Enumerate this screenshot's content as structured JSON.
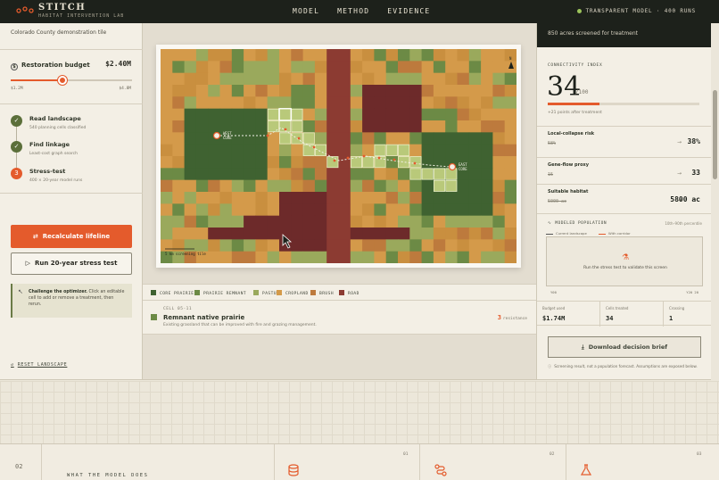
{
  "nav": {
    "title": "STITCH",
    "subtitle": "HABITAT INTERVENTION LAB",
    "links": [
      "MODEL",
      "METHOD",
      "EVIDENCE"
    ],
    "status": "TRANSPARENT MODEL · 400 RUNS"
  },
  "left": {
    "tile_label": "Colorado County demonstration tile",
    "budget_label": "Restoration budget",
    "budget_value": "$2.40M",
    "slider_min": "$1.2M",
    "slider_max": "$4.8M",
    "slider_fraction": 0.43,
    "steps": [
      {
        "title": "Read landscape",
        "sub": "540 planning cells classified",
        "marker": "✓"
      },
      {
        "title": "Find linkage",
        "sub": "Least-cost graph search",
        "marker": "✓"
      },
      {
        "title": "Stress-test",
        "sub": "400 × 20-year model runs",
        "marker": "3"
      }
    ],
    "recalc_label": "Recalculate lifeline",
    "stress_label": "Run 20-year stress test",
    "tip_bold": "Challenge the optimizer.",
    "tip_text": " Click an editable cell to add or remove a treatment, then rerun.",
    "reset_label": "RESET LANDSCAPE"
  },
  "map": {
    "west_label": [
      "WEST",
      "CORE"
    ],
    "east_label": [
      "EAST",
      "CORE"
    ],
    "scale_label": "5 km screening tile",
    "north": "N",
    "colors": {
      "core": "#3f6231",
      "remnant": "#6c8a45",
      "pasture": "#9aa95c",
      "cropland": "#d49a4a",
      "brush": "#bd7a3d",
      "road": "#8c3b32",
      "crop_alt": "#c98f3f",
      "dark": "#6d2a2a"
    }
  },
  "legend": [
    {
      "label": "CORE PRAIRIE",
      "color": "#3f6231"
    },
    {
      "label": "PRAIRIE REMNANT",
      "color": "#6c8a45"
    },
    {
      "label": "PASTURE",
      "color": "#9aa95c"
    },
    {
      "label": "CROPLAND",
      "color": "#d49a4a"
    },
    {
      "label": "BRUSH",
      "color": "#bd7a3d"
    },
    {
      "label": "ROAD",
      "color": "#8c3b32"
    }
  ],
  "cell": {
    "id": "CELL 05-11",
    "name": "Remnant native prairie",
    "desc": "Existing grassland that can be improved with fire and grazing management.",
    "resistance_value": "3",
    "resistance_label": "resistance"
  },
  "right": {
    "top_text": "850 acres screened for treatment",
    "conn_label": "CONNECTIVITY INDEX",
    "conn_value": "34",
    "conn_of": "/100",
    "conn_fraction": 0.34,
    "conn_note": "+21 points after treatment",
    "metrics": [
      {
        "label": "Local-collapse risk",
        "old": "58%",
        "value": "38%"
      },
      {
        "label": "Gene-flow proxy",
        "old": "15",
        "value": "33"
      },
      {
        "label": "Suitable habitat",
        "old": "5000 ac",
        "value": "5800 ac"
      }
    ],
    "pop_head": "MODELED POPULATION",
    "pop_pct": "10th–90th percentile",
    "pop_legend_a": "Current landscape",
    "pop_legend_b": "With corridor",
    "pop_msg": "Run the stress test to validate this screen",
    "pop_axis_l": "Y00",
    "pop_axis_r": "Y20 20",
    "stats": [
      {
        "label": "Budget used",
        "value": "$1.74M"
      },
      {
        "label": "Cells treated",
        "value": "34"
      },
      {
        "label": "Crossing",
        "value": "1"
      }
    ],
    "download_label": "Download decision brief",
    "footnote": "Screening result, not a population forecast. Assumptions are exposed below."
  },
  "bottom": {
    "num": "02",
    "title": "WHAT THE MODEL DOES",
    "idx": [
      "01",
      "02",
      "03"
    ]
  }
}
